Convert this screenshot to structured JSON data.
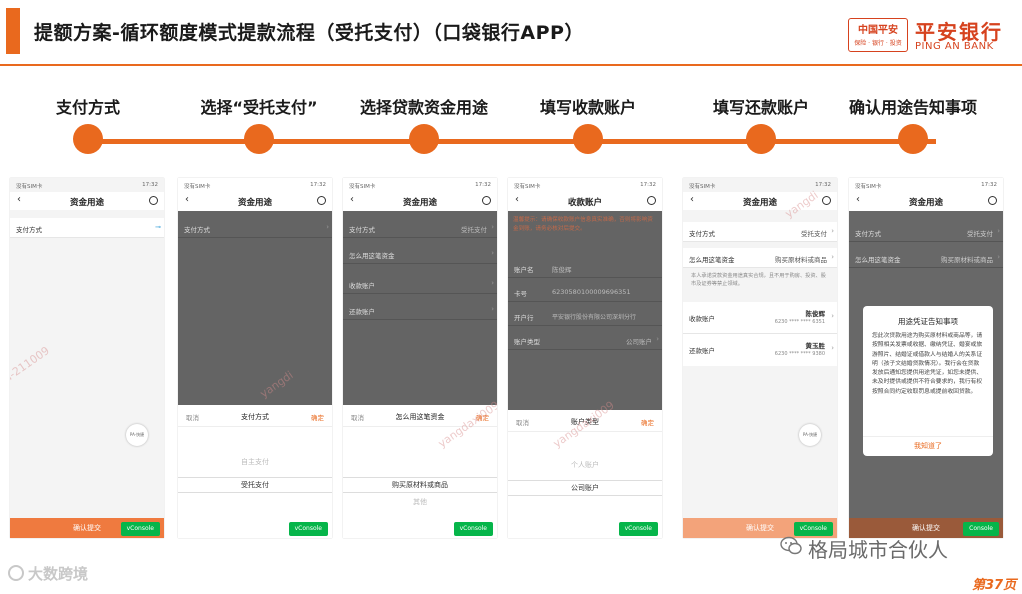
{
  "header": {
    "title": "提额方案-循环额度模式提款流程（受托支付）（口袋银行APP）",
    "logo": {
      "cn": "中国平安",
      "en_small": "保险 · 银行 · 投资",
      "bank": "平安银行",
      "bank_en": "PING AN BANK"
    }
  },
  "steps": [
    {
      "label": "支付方式"
    },
    {
      "label": "选择“受托支付”"
    },
    {
      "label": "选择贷款资金用途"
    },
    {
      "label": "填写收款账户"
    },
    {
      "label": "填写还款账户"
    },
    {
      "label": "确认用途告知事项"
    }
  ],
  "common": {
    "status_left": "没有SIM卡",
    "status_right": "71%",
    "time": "17:32",
    "vconsole": "vConsole",
    "back": "‹",
    "title": "资金用途",
    "pay_method": "支付方式",
    "usage": "怎么用这笔资金",
    "receive_acct": "收款账户",
    "repay_acct": "还款账户",
    "cancel": "取消",
    "confirm": "确定",
    "confirm_submit": "确认提交",
    "entrusted": "受托支付",
    "self_pay": "自主支付",
    "material": "购买原材料或商品",
    "other": "其他",
    "pa_badge": "PA·快捷"
  },
  "phone4": {
    "title": "收款账户",
    "notice": "温馨提示：请确保收款账户信息真实准确，否则将影响资金到账，请务必核对后提交。",
    "rows": [
      {
        "k": "账户名",
        "v": "陈俊辉"
      },
      {
        "k": "卡号",
        "v": "6230580100009696351"
      },
      {
        "k": "开户行",
        "v": "平安银行股份有限公司深圳分行"
      },
      {
        "k": "账户类型",
        "v": "公司账户"
      }
    ],
    "sheet_title": "账户类型",
    "opt_personal": "个人账户",
    "opt_company": "公司账户"
  },
  "phone5": {
    "pay_v": "受托支付",
    "usage_v": "购买原材料或商品",
    "tip": "本人承诺贷款资金用途真实合规，且不用于购房、投资、股市及证券等禁止领域。",
    "receive_name": "陈俊辉",
    "receive_no": "6230 **** **** 6351",
    "repay_name": "黄玉胜",
    "repay_no": "6230 **** **** 9380"
  },
  "phone6": {
    "modal_title": "用途凭证告知事项",
    "modal_body": "您此次贷款用途为购买原材料或商品等，请按照相关发票或收据、缴纳凭证、婚宴或旅游照片、结婚证或借款人与结婚人的关系证明（孩子文结婚贷款情况）。我行会在贷款发放后通知您提供用途凭证，如您未提供、未及时提供或提供不符合要求的，我行有权按照合同约定收取罚息或提前收回贷款。",
    "modal_ok": "我知道了",
    "console": "Console"
  },
  "footer": {
    "left": "大数跨境",
    "center": "格局城市合伙人",
    "page": "第37页"
  },
  "colors": {
    "accent": "#e9691e",
    "vconsole": "#06b54a",
    "bank_red": "#d6421e"
  }
}
